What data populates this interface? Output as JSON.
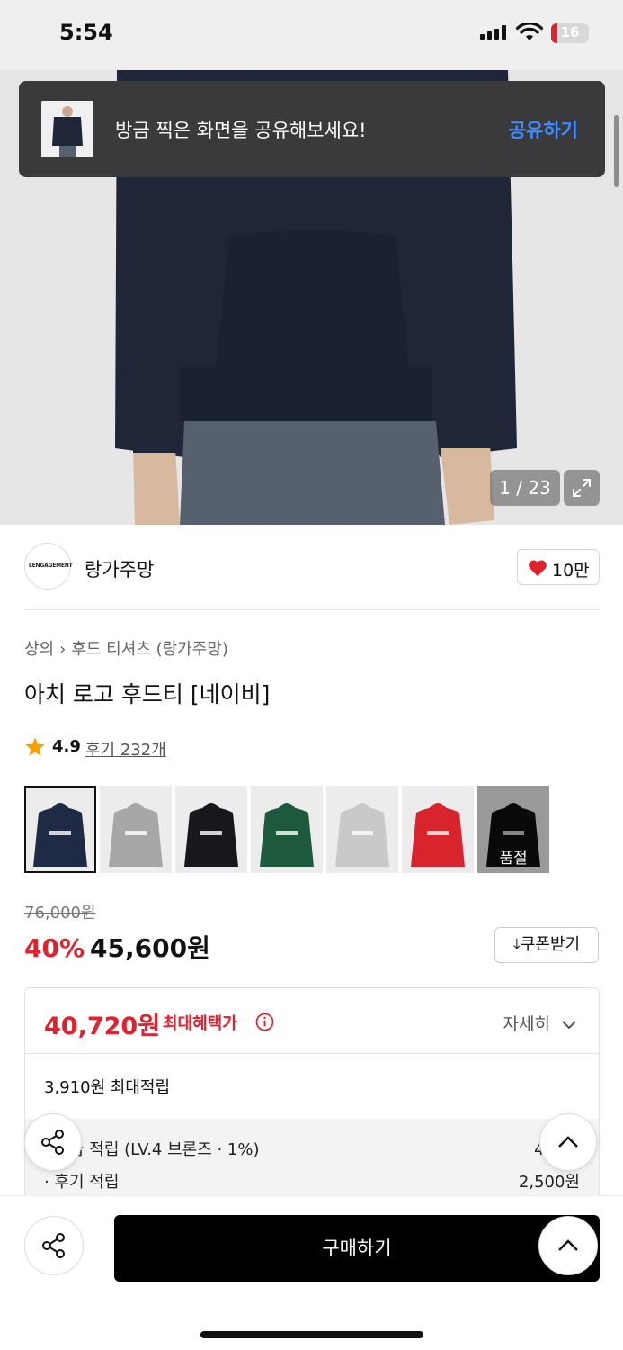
{
  "status_bar": {
    "time": "5:54",
    "battery": "16"
  },
  "share_toast": {
    "message": "방금 찍은 화면을 공유해보세요!",
    "action": "공유하기"
  },
  "gallery": {
    "counter": "1 / 23"
  },
  "brand": {
    "logo_text": "LENGAGEMENT",
    "name": "랑가주망",
    "likes": "10만"
  },
  "breadcrumb": {
    "category": "상의",
    "subcategory": "후드 티셔츠 (랑가주망)"
  },
  "product": {
    "title": "아치 로고 후드티 [네이비]"
  },
  "rating": {
    "score": "4.9",
    "reviews": "후기 232개"
  },
  "variants": [
    {
      "color": "#1f2a44",
      "selected": true,
      "sold_out": false
    },
    {
      "color": "#a7a7a7",
      "selected": false,
      "sold_out": false
    },
    {
      "color": "#17181c",
      "selected": false,
      "sold_out": false
    },
    {
      "color": "#1d5a3c",
      "selected": false,
      "sold_out": false
    },
    {
      "color": "#c8c9cb",
      "selected": false,
      "sold_out": false
    },
    {
      "color": "#d8242c",
      "selected": false,
      "sold_out": false
    },
    {
      "color": "#0e0e0e",
      "selected": false,
      "sold_out": true,
      "label": "품절"
    }
  ],
  "price": {
    "original": "76,000원",
    "discount": "40%",
    "sale": "45,600원",
    "coupon_button": "쿠폰받기"
  },
  "benefit": {
    "max_price": "40,720원",
    "max_label": "최대혜택가",
    "detail_button": "자세히",
    "points_max": "3,910원 최대적립",
    "lines": [
      {
        "label": "· 등급 적립 (LV.4 브론즈 · 1%)",
        "amount": "456원"
      },
      {
        "label": "· 후기 적립",
        "amount": "2,500원"
      }
    ]
  },
  "bottom_bar": {
    "buy_label": "구매하기"
  },
  "colors": {
    "accent_red": "#e0212e",
    "link_blue": "#3f8cff",
    "toast_bg": "#3a3a3c"
  }
}
